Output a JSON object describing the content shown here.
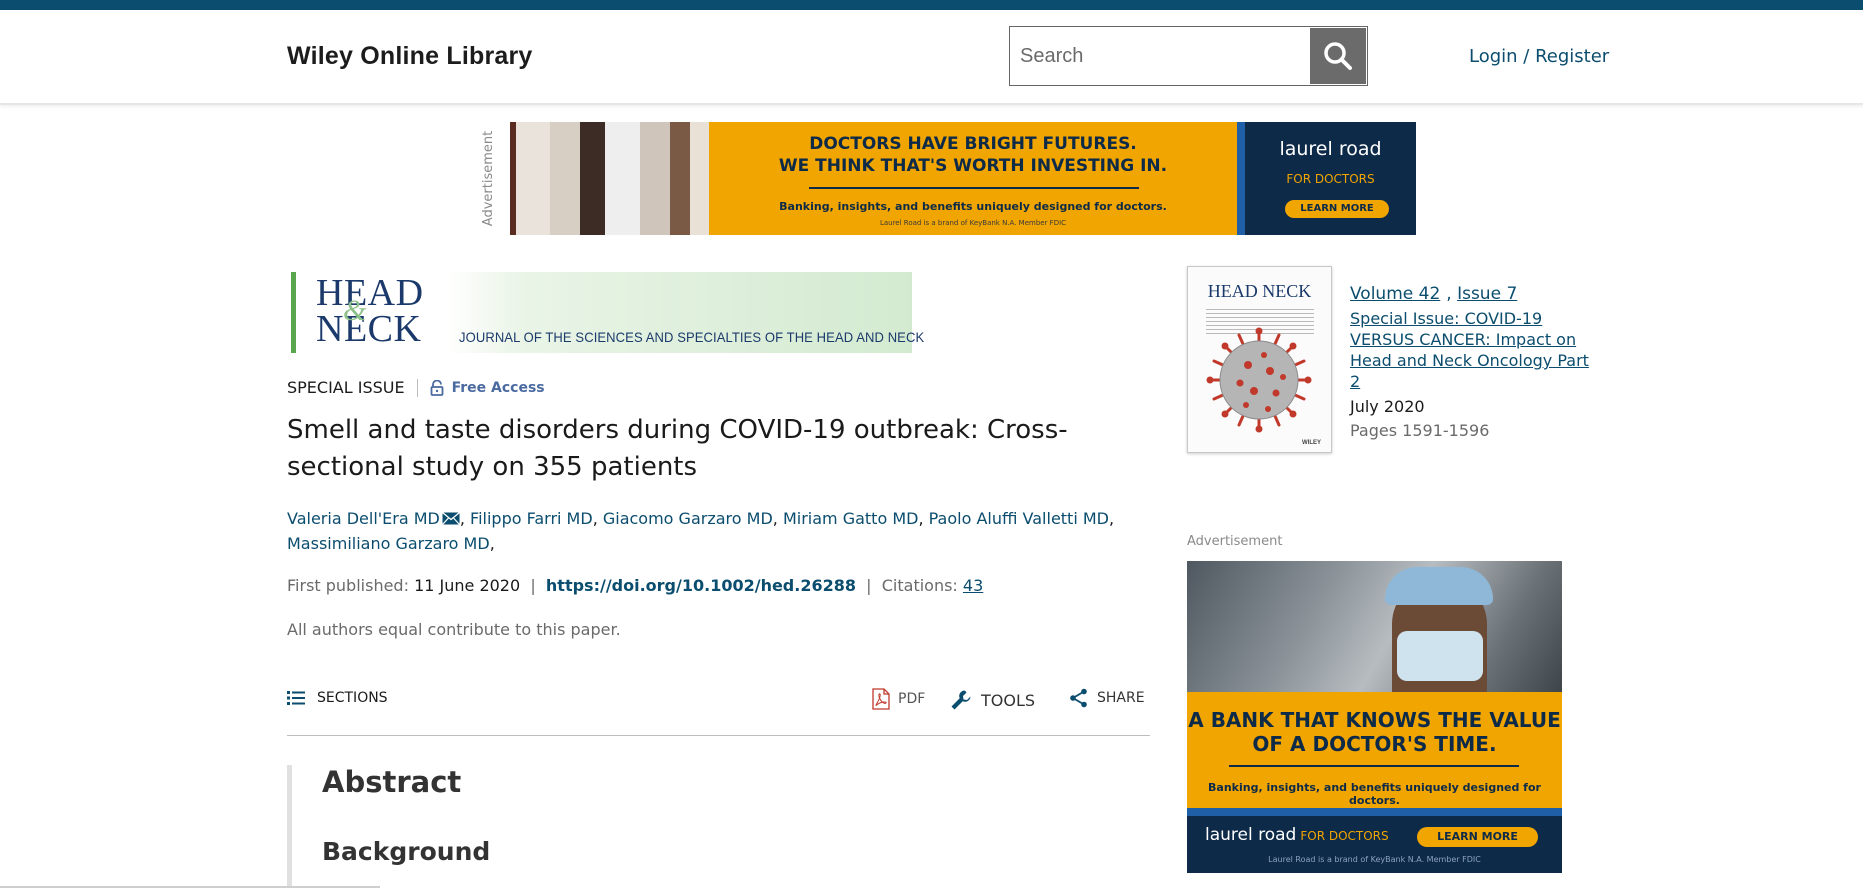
{
  "header": {
    "logo": "Wiley Online Library",
    "search_placeholder": "Search",
    "login": "Login / Register"
  },
  "ad_top": {
    "label": "Advertisement",
    "line1": "DOCTORS HAVE BRIGHT FUTURES.",
    "line2": "WE THINK THAT'S WORTH INVESTING IN.",
    "line3": "Banking, insights, and benefits uniquely designed for doctors.",
    "fine": "Laurel Road is a brand of KeyBank N.A. Member FDIC",
    "brand": "laurel road",
    "brand_sub": "FOR DOCTORS",
    "cta": "LEARN MORE"
  },
  "journal": {
    "banner_head": "HEAD NECK",
    "banner_amp": "&",
    "banner_sub": "JOURNAL OF THE SCIENCES AND SPECIALTIES OF THE HEAD AND NECK"
  },
  "article": {
    "type": "SPECIAL ISSUE",
    "access": "Free Access",
    "title": "Smell and taste disorders during COVID-19 outbreak: Cross-sectional study on 355 patients",
    "authors": [
      "Valeria Dell'Era MD",
      "Filippo Farri MD",
      "Giacomo Garzaro MD",
      "Miriam Gatto MD",
      "Paolo Aluffi Valletti MD",
      "Massimiliano Garzaro MD"
    ],
    "first_published_label": "First published:",
    "first_published": "11 June 2020",
    "doi": "https://doi.org/10.1002/hed.26288",
    "citations_label": "Citations:",
    "citations": "43",
    "note": "All authors equal contribute to this paper."
  },
  "toolbar": {
    "sections": "SECTIONS",
    "pdf": "PDF",
    "tools": "TOOLS",
    "share": "SHARE"
  },
  "abstract": {
    "heading": "Abstract",
    "subheading": "Background"
  },
  "issue": {
    "cover_title": "HEAD NECK",
    "cover_publisher": "WILEY",
    "volume": "Volume 42",
    "issue": "Issue 7",
    "special": "Special Issue: COVID-19 VERSUS CANCER: Impact on Head and Neck Oncology Part 2",
    "date": "July 2020",
    "pages": "Pages 1591-1596"
  },
  "ad_side": {
    "label": "Advertisement",
    "line1": "A BANK THAT KNOWS THE VALUE",
    "line2": "OF A DOCTOR'S TIME.",
    "line3": "Banking, insights, and benefits uniquely designed for doctors.",
    "brand": "laurel road",
    "brand_sub": "FOR DOCTORS",
    "cta": "LEARN MORE",
    "fine": "Laurel Road is a brand of KeyBank N.A. Member FDIC"
  },
  "colors": {
    "brand_blue": "#0b4d6e",
    "ad_yellow": "#f0a500",
    "ad_navy": "#0d2a48"
  }
}
